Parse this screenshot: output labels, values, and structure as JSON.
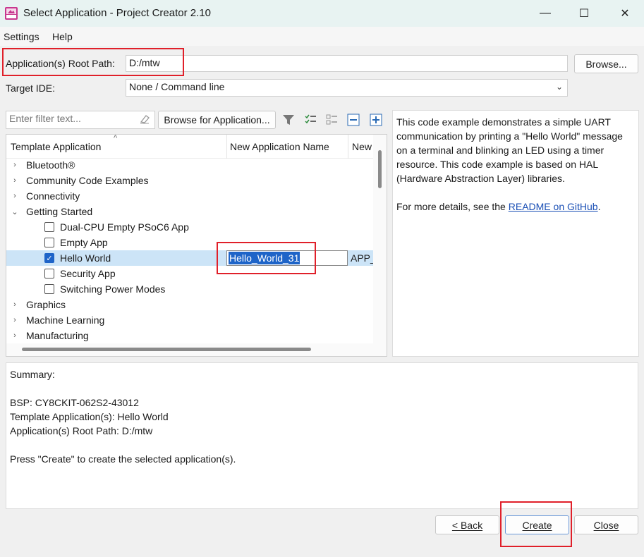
{
  "window": {
    "title": "Select Application - Project Creator 2.10",
    "controls": [
      "—",
      "☐",
      "✕"
    ]
  },
  "menu": {
    "settings": "Settings",
    "help": "Help"
  },
  "form": {
    "root_path_label": "Application(s) Root Path:",
    "root_path_value": "D:/mtw",
    "browse_label": "Browse...",
    "target_ide_label": "Target IDE:",
    "target_ide_value": "None / Command line"
  },
  "toolbar": {
    "filter_placeholder": "Enter filter text...",
    "browse_apps_label": "Browse for Application..."
  },
  "tree": {
    "columns": [
      "Template Application",
      "New Application Name",
      "New"
    ],
    "categories_top": [
      "Bluetooth®",
      "Community Code Examples",
      "Connectivity"
    ],
    "open_category": "Getting Started",
    "children": [
      {
        "label": "Dual-CPU Empty PSoC6 App",
        "checked": false
      },
      {
        "label": "Empty App",
        "checked": false
      },
      {
        "label": "Hello World",
        "checked": true
      },
      {
        "label": "Security App",
        "checked": false
      },
      {
        "label": "Switching Power Modes",
        "checked": false
      }
    ],
    "categories_bottom": [
      "Graphics",
      "Machine Learning",
      "Manufacturing"
    ],
    "selected_name_value": "Hello_World_31",
    "selected_extra_value": "APP_"
  },
  "description": {
    "text": "This code example demonstrates a simple UART communication by printing a \"Hello World\" message on a terminal and blinking an LED using a timer resource. This code example is based on HAL (Hardware Abstraction Layer) libraries.",
    "details_prefix": "For more details, see the ",
    "link_text": "README on GitHub",
    "details_suffix": "."
  },
  "summary": {
    "heading": "Summary:",
    "bsp": "BSP: CY8CKIT-062S2-43012",
    "template": "Template Application(s): Hello World",
    "root_path": "Application(s) Root Path: D:/mtw",
    "instruction": "Press \"Create\" to create the selected application(s)."
  },
  "buttons": {
    "back": "< Back",
    "create": "Create",
    "close": "Close"
  },
  "colors": {
    "accent": "#1e64c8",
    "highlight_box": "#e0202a",
    "selection_row": "#cce4f7"
  }
}
